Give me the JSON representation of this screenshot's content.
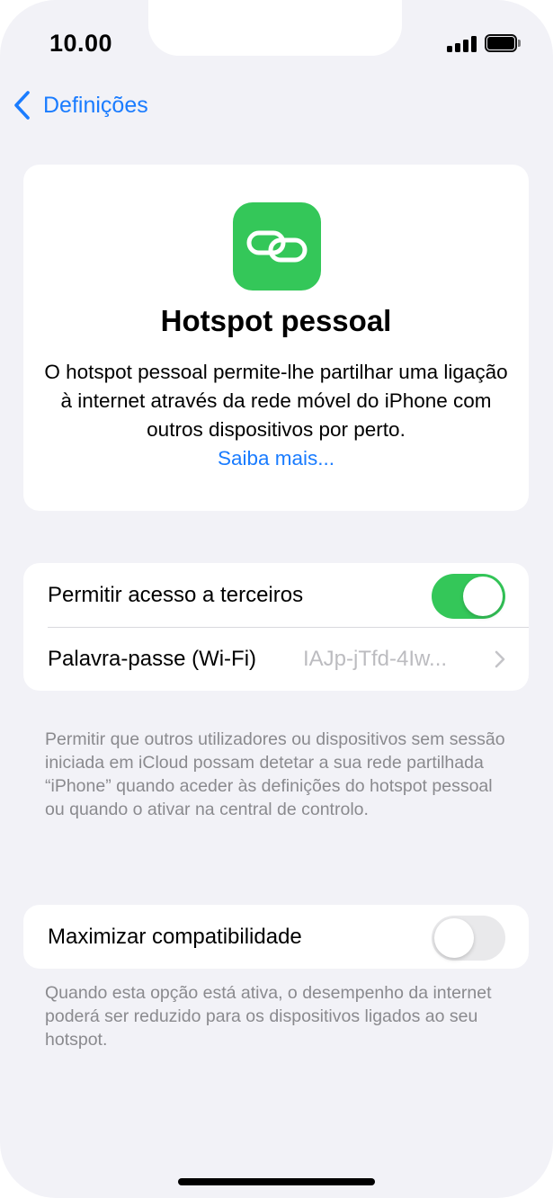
{
  "status_bar": {
    "time": "10.00"
  },
  "nav": {
    "back_label": "Definições"
  },
  "hero": {
    "icon": "link-icon",
    "title": "Hotspot pessoal",
    "description": "O hotspot pessoal permite-lhe partilhar uma ligação à internet através da rede móvel do iPhone com outros dispositivos por perto.",
    "link": "Saiba mais..."
  },
  "settings": {
    "allow_others": {
      "label": "Permitir acesso a terceiros",
      "enabled": true
    },
    "password": {
      "label": "Palavra-passe (Wi-Fi)",
      "value": "IAJp-jTfd-4Iw..."
    },
    "allow_others_note": "Permitir que outros utilizadores ou dispositivos sem sessão iniciada em iCloud possam detetar a sua rede partilhada “iPhone” quando aceder às definições do hotspot pessoal ou quando o ativar na central de controlo.",
    "max_compat": {
      "label": "Maximizar compatibilidade",
      "enabled": false
    },
    "max_compat_note": "Quando esta opção está ativa, o desempenho da internet poderá ser reduzido para os dispositivos ligados ao seu hotspot."
  },
  "colors": {
    "accent": "#1a7cff",
    "toggle_on": "#34c759",
    "background": "#f2f2f7"
  }
}
